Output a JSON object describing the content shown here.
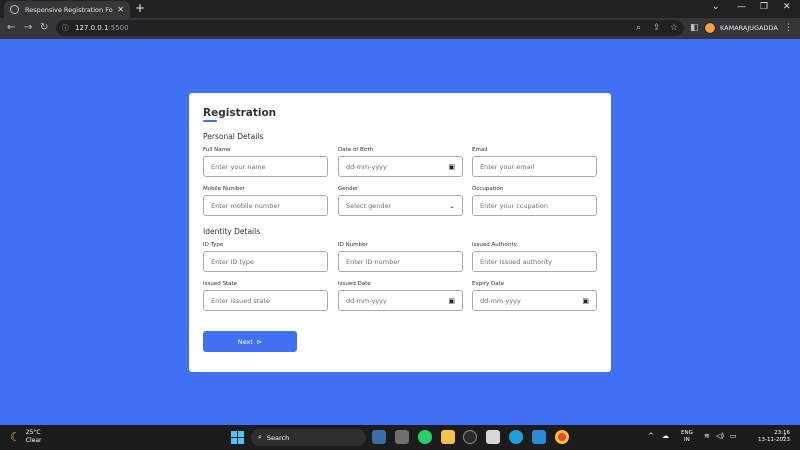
{
  "browser": {
    "tab_title": "Responsive Registration Form",
    "new_tab": "+",
    "url_host": "127.0.0.1",
    "url_port": ":5500",
    "profile_name": "KAMARAJUGADDA"
  },
  "form": {
    "title": "Registration",
    "personal_title": "Personal Details",
    "identity_title": "Identity Details",
    "fields": {
      "full_name": {
        "label": "Full Name",
        "placeholder": "Enter your name"
      },
      "dob": {
        "label": "Date of Birth",
        "placeholder": "dd-mm-yyyy"
      },
      "email": {
        "label": "Email",
        "placeholder": "Enter your email"
      },
      "mobile": {
        "label": "Mobile Number",
        "placeholder": "Enter mobile number"
      },
      "gender": {
        "label": "Gender",
        "placeholder": "Select gender"
      },
      "occupation": {
        "label": "Occupation",
        "placeholder": "Enter your ccupation"
      },
      "id_type": {
        "label": "ID Type",
        "placeholder": "Enter ID type"
      },
      "id_number": {
        "label": "ID Number",
        "placeholder": "Enter ID number"
      },
      "issued_authority": {
        "label": "Issued Authority",
        "placeholder": "Enter issued authority"
      },
      "issued_state": {
        "label": "Issued State",
        "placeholder": "Enter issued state"
      },
      "issued_date": {
        "label": "Issued Date",
        "placeholder": "dd-mm-yyyy"
      },
      "expiry_date": {
        "label": "Expiry Date",
        "placeholder": "dd-mm-yyyy"
      }
    },
    "next_label": "Next"
  },
  "taskbar": {
    "temp": "25°C",
    "condition": "Clear",
    "search_label": "Search",
    "lang_top": "ENG",
    "lang_bottom": "IN",
    "time": "23:16",
    "date": "13-11-2023"
  },
  "colors": {
    "page_bg": "#4070f4",
    "accent": "#4070f4"
  }
}
